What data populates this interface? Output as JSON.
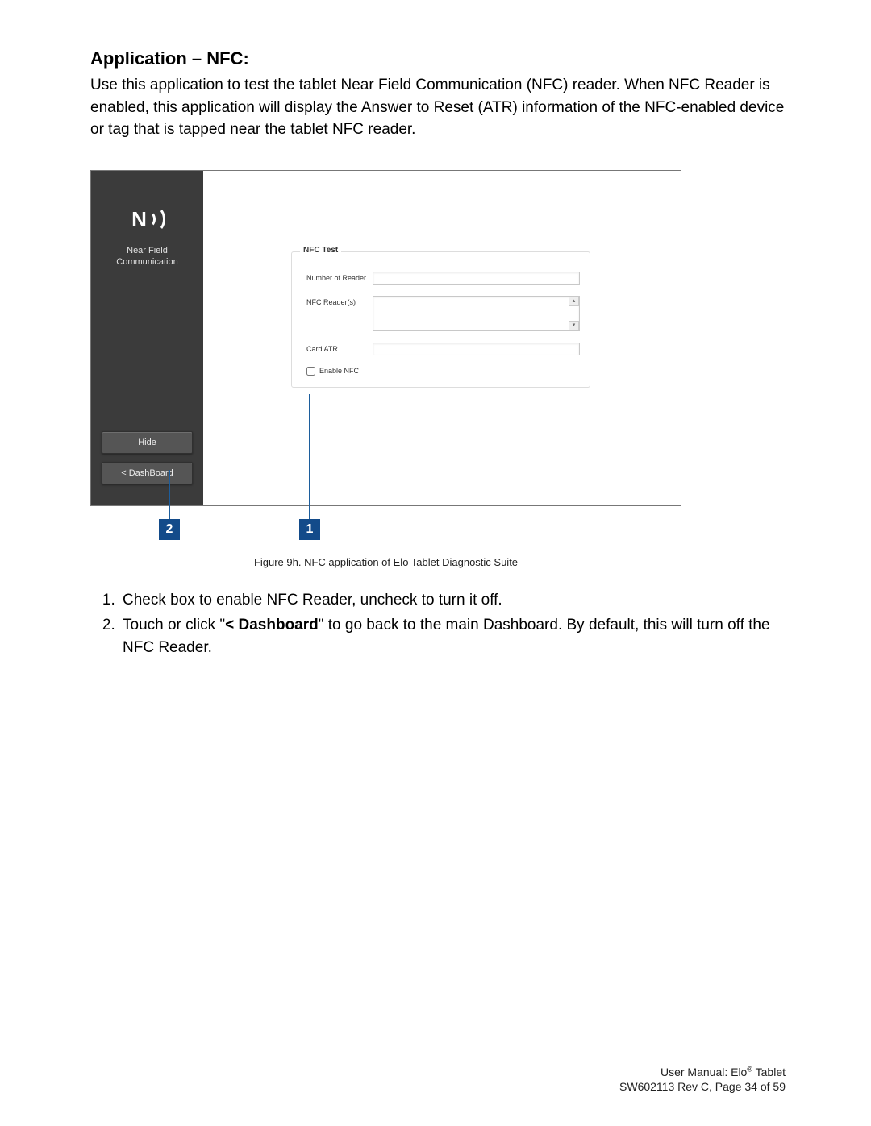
{
  "heading": "Application – NFC:",
  "intro": "Use this application to test the tablet Near Field Communication (NFC) reader. When NFC Reader is enabled, this application will display the Answer to Reset (ATR) information of the NFC-enabled device or tag that is tapped near the tablet NFC reader.",
  "sidebar": {
    "title_line1": "Near Field",
    "title_line2": "Communication",
    "hide_label": "Hide",
    "dashboard_label": "< DashBoard",
    "nfc_letter": "N"
  },
  "panel": {
    "legend": "NFC Test",
    "num_reader_label": "Number of Reader",
    "readers_label": "NFC Reader(s)",
    "card_atr_label": "Card ATR",
    "enable_label": "Enable NFC",
    "scroll_up": "▴",
    "scroll_down": "▾"
  },
  "callouts": {
    "one": "1",
    "two": "2"
  },
  "figure_caption": "Figure 9h. NFC application of Elo Tablet Diagnostic Suite",
  "list": {
    "item1": "Check box to enable NFC Reader, uncheck to turn it off.",
    "item2_pre": "Touch or click \"",
    "item2_bold": "< Dashboard",
    "item2_post": "\" to go back to the main Dashboard. By default, this will turn off the NFC Reader."
  },
  "footer": {
    "line1_pre": "User Manual: Elo",
    "line1_sup": "®",
    "line1_post": " Tablet",
    "line2": "SW602113 Rev C, Page 34 of 59"
  }
}
